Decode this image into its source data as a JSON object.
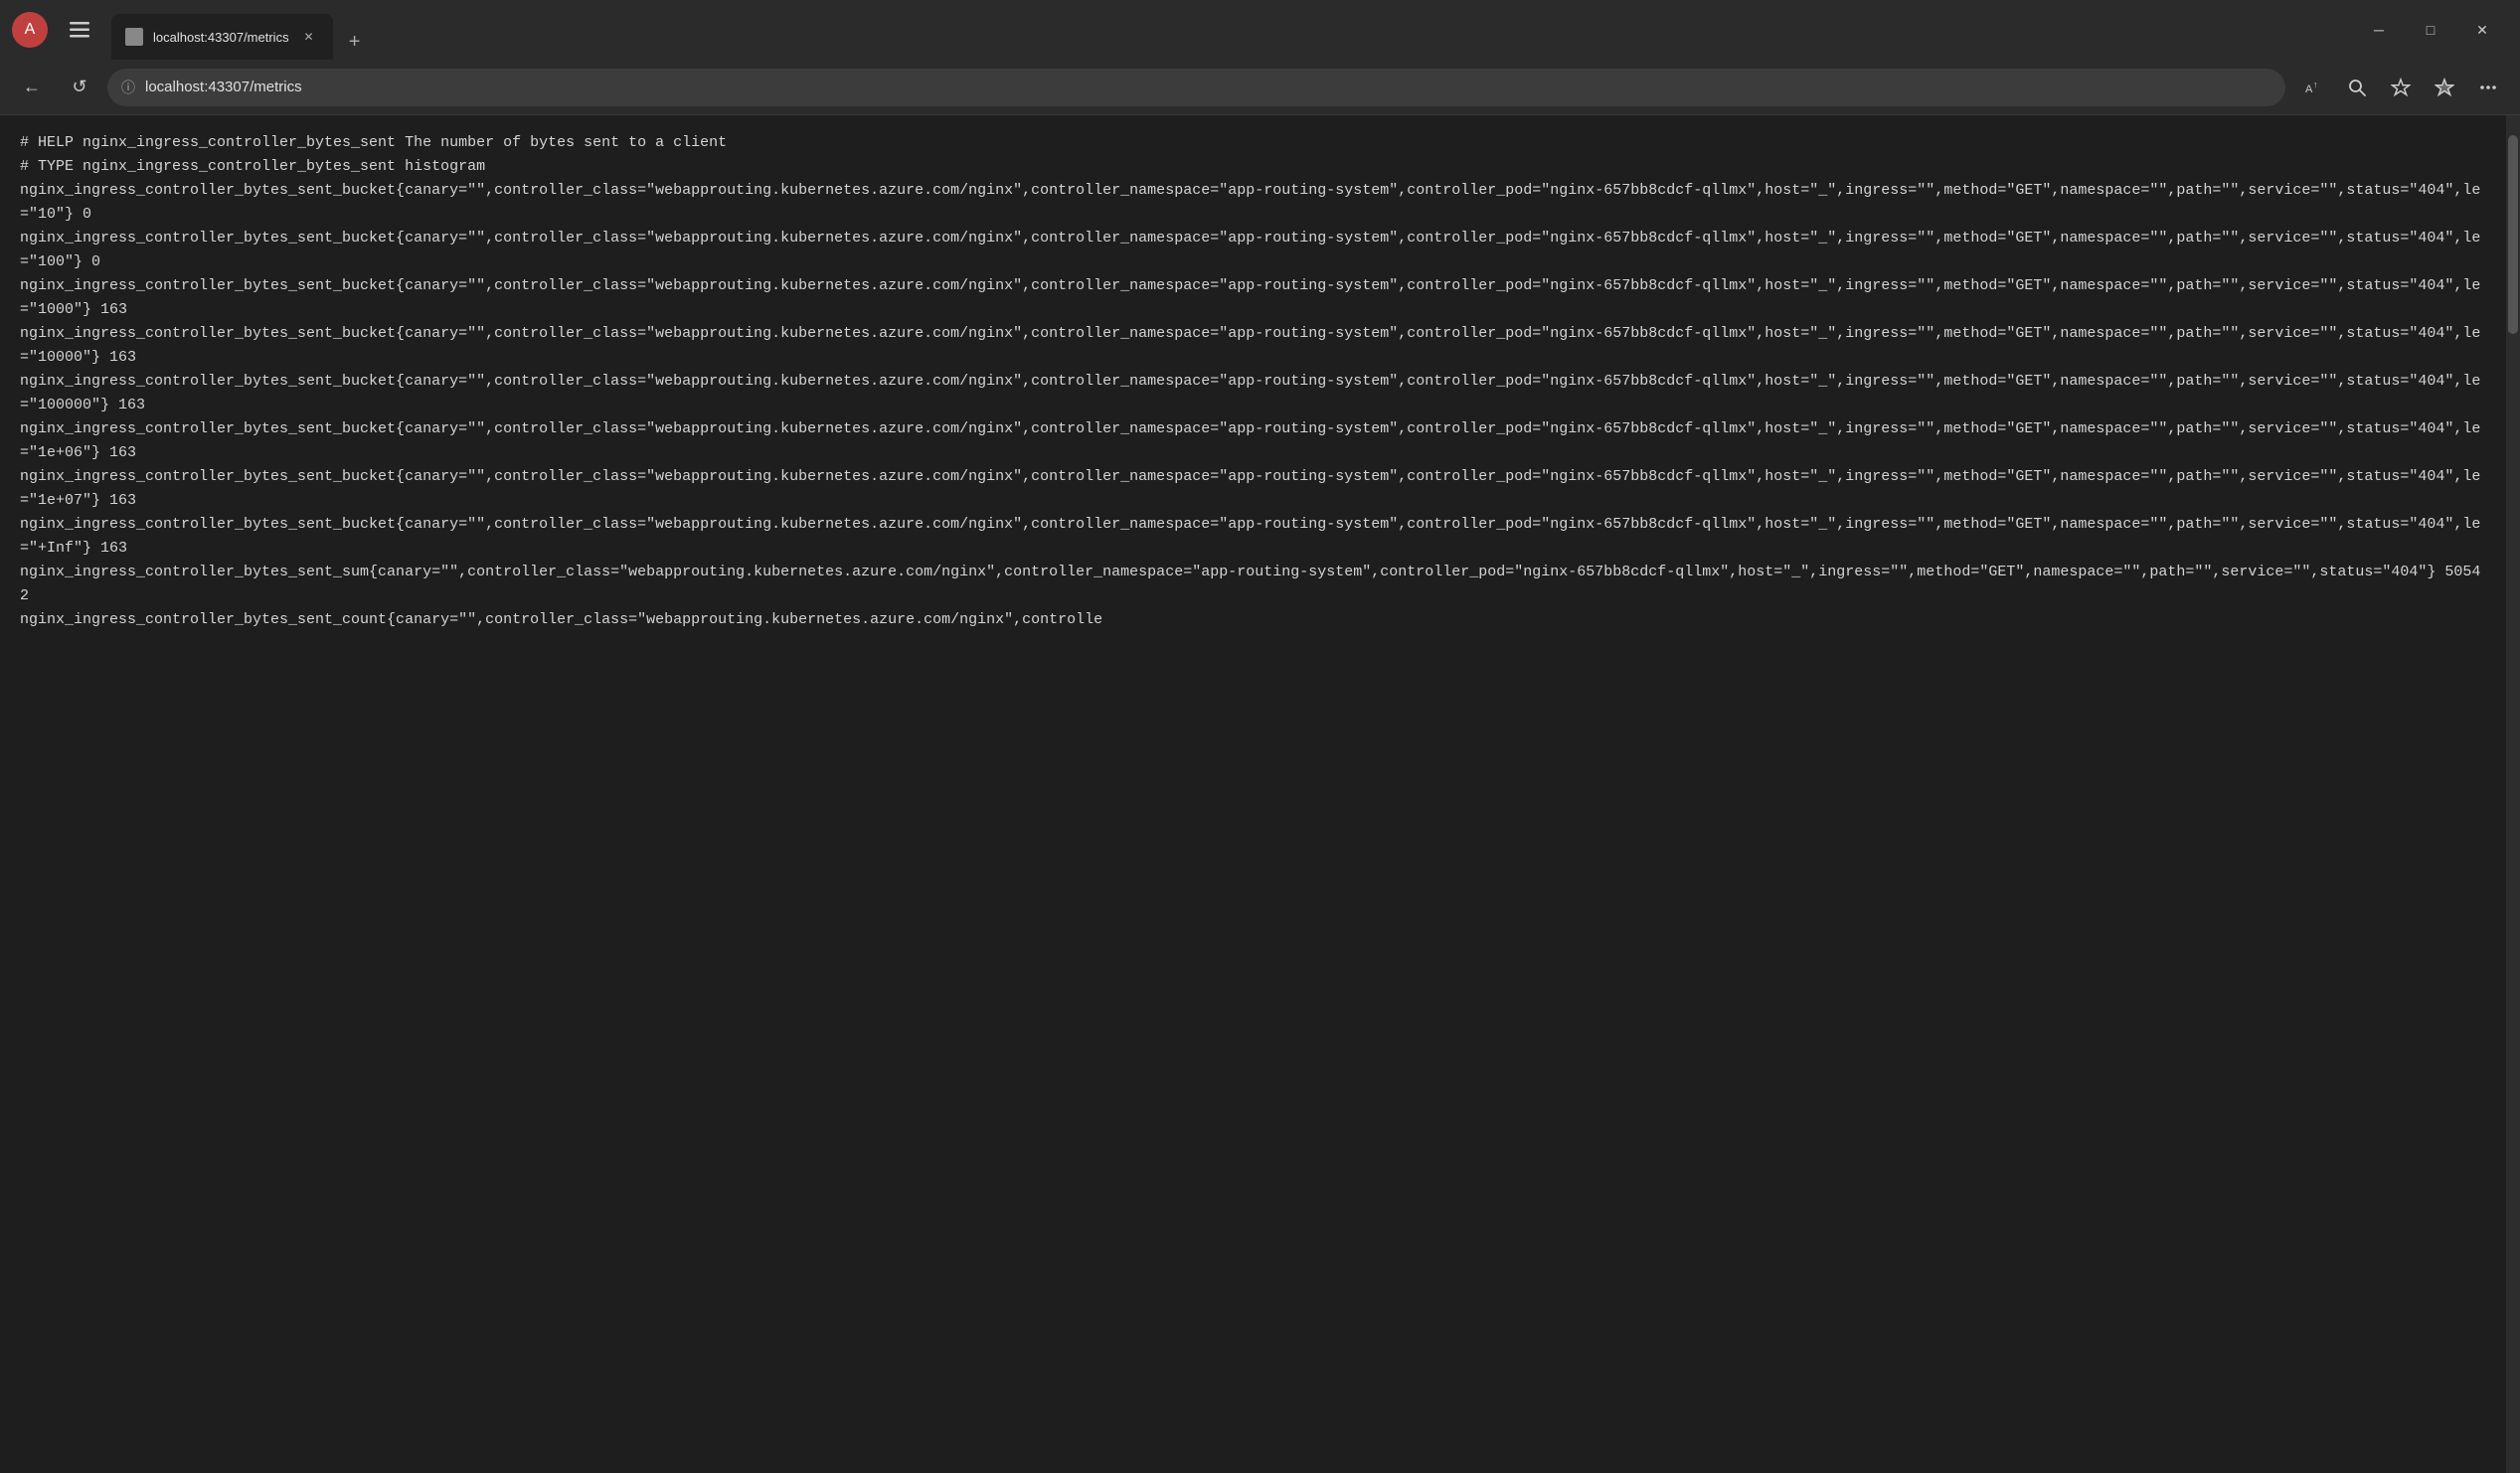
{
  "titlebar": {
    "avatar_letter": "A",
    "tab_favicon": "🌐",
    "tab_title": "localhost:43307/metrics",
    "tab_close": "✕",
    "new_tab": "+",
    "window_minimize": "─",
    "window_maximize": "□",
    "window_close": "✕"
  },
  "navbar": {
    "back_icon": "←",
    "refresh_icon": "↺",
    "lock_icon": "ⓘ",
    "address": "localhost:43307/metrics",
    "read_aloud_icon": "A↑",
    "search_icon": "🔍",
    "favorites_icon": "☆",
    "collections_icon": "★",
    "more_icon": "…"
  },
  "content": {
    "lines": [
      "# HELP nginx_ingress_controller_bytes_sent The number of bytes sent to a client",
      "# TYPE nginx_ingress_controller_bytes_sent histogram",
      "nginx_ingress_controller_bytes_sent_bucket{canary=\"\",controller_class=\"webapprouting.kubernetes.azure.com/nginx\",controller_namespace=\"app-routing-system\",controller_pod=\"nginx-657bb8cdcf-qllmx\",host=\"_\",ingress=\"\",method=\"GET\",namespace=\"\",path=\"\",service=\"\",status=\"404\",le=\"10\"} 0",
      "nginx_ingress_controller_bytes_sent_bucket{canary=\"\",controller_class=\"webapprouting.kubernetes.azure.com/nginx\",controller_namespace=\"app-routing-system\",controller_pod=\"nginx-657bb8cdcf-qllmx\",host=\"_\",ingress=\"\",method=\"GET\",namespace=\"\",path=\"\",service=\"\",status=\"404\",le=\"100\"} 0",
      "nginx_ingress_controller_bytes_sent_bucket{canary=\"\",controller_class=\"webapprouting.kubernetes.azure.com/nginx\",controller_namespace=\"app-routing-system\",controller_pod=\"nginx-657bb8cdcf-qllmx\",host=\"_\",ingress=\"\",method=\"GET\",namespace=\"\",path=\"\",service=\"\",status=\"404\",le=\"1000\"} 163",
      "nginx_ingress_controller_bytes_sent_bucket{canary=\"\",controller_class=\"webapprouting.kubernetes.azure.com/nginx\",controller_namespace=\"app-routing-system\",controller_pod=\"nginx-657bb8cdcf-qllmx\",host=\"_\",ingress=\"\",method=\"GET\",namespace=\"\",path=\"\",service=\"\",status=\"404\",le=\"10000\"} 163",
      "nginx_ingress_controller_bytes_sent_bucket{canary=\"\",controller_class=\"webapprouting.kubernetes.azure.com/nginx\",controller_namespace=\"app-routing-system\",controller_pod=\"nginx-657bb8cdcf-qllmx\",host=\"_\",ingress=\"\",method=\"GET\",namespace=\"\",path=\"\",service=\"\",status=\"404\",le=\"100000\"} 163",
      "nginx_ingress_controller_bytes_sent_bucket{canary=\"\",controller_class=\"webapprouting.kubernetes.azure.com/nginx\",controller_namespace=\"app-routing-system\",controller_pod=\"nginx-657bb8cdcf-qllmx\",host=\"_\",ingress=\"\",method=\"GET\",namespace=\"\",path=\"\",service=\"\",status=\"404\",le=\"1e+06\"} 163",
      "nginx_ingress_controller_bytes_sent_bucket{canary=\"\",controller_class=\"webapprouting.kubernetes.azure.com/nginx\",controller_namespace=\"app-routing-system\",controller_pod=\"nginx-657bb8cdcf-qllmx\",host=\"_\",ingress=\"\",method=\"GET\",namespace=\"\",path=\"\",service=\"\",status=\"404\",le=\"1e+07\"} 163",
      "nginx_ingress_controller_bytes_sent_bucket{canary=\"\",controller_class=\"webapprouting.kubernetes.azure.com/nginx\",controller_namespace=\"app-routing-system\",controller_pod=\"nginx-657bb8cdcf-qllmx\",host=\"_\",ingress=\"\",method=\"GET\",namespace=\"\",path=\"\",service=\"\",status=\"404\",le=\"+Inf\"} 163",
      "nginx_ingress_controller_bytes_sent_sum{canary=\"\",controller_class=\"webapprouting.kubernetes.azure.com/nginx\",controller_namespace=\"app-routing-system\",controller_pod=\"nginx-657bb8cdcf-qllmx\",host=\"_\",ingress=\"\",method=\"GET\",namespace=\"\",path=\"\",service=\"\",status=\"404\"} 50542",
      "nginx_ingress_controller_bytes_sent_count{canary=\"\",controller_class=\"webapprouting.kubernetes.azure.com/nginx\",controlle"
    ]
  }
}
